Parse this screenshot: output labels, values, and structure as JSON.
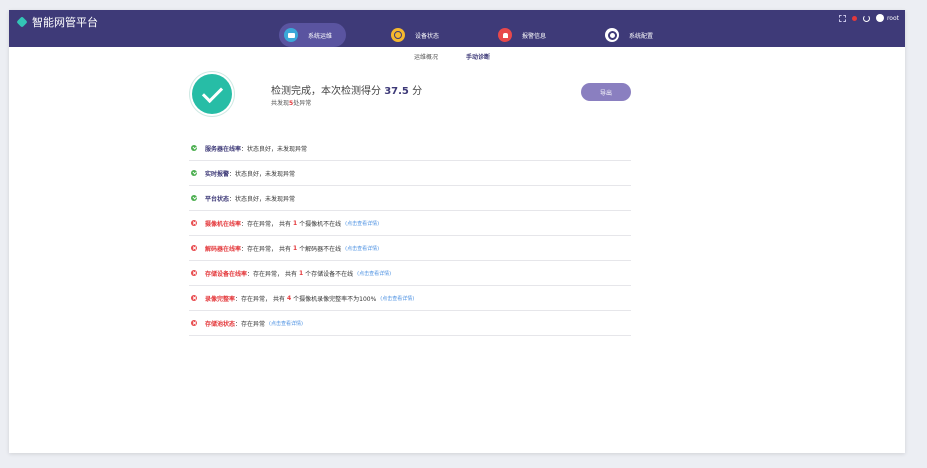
{
  "app": {
    "title": "智能网管平台"
  },
  "nav": [
    {
      "label": "系统运维",
      "icon": "monitor-icon",
      "color": "#3ba8d8",
      "active": true
    },
    {
      "label": "设备状态",
      "icon": "chart-icon",
      "color": "#f5b82e",
      "active": false
    },
    {
      "label": "报警信息",
      "icon": "bell-icon",
      "color": "#e8484b",
      "active": false
    },
    {
      "label": "系统配置",
      "icon": "gear-icon",
      "color": "#ffffff",
      "active": false
    }
  ],
  "topbar": {
    "user": "root"
  },
  "subtabs": [
    {
      "label": "运维概况",
      "active": false
    },
    {
      "label": "手动诊断",
      "active": true
    }
  ],
  "summary": {
    "title_prefix": "检测完成，本次检测得分",
    "score": "37.5",
    "title_suffix": "分",
    "sub_prefix": "共发现",
    "issue_count": "5",
    "sub_suffix": "处异常",
    "export_label": "导出"
  },
  "results": [
    {
      "status": "ok",
      "label": "服务器在线率",
      "desc": "状态良好，未发现异常"
    },
    {
      "status": "ok",
      "label": "实时报警",
      "desc": "状态良好，未发现异常"
    },
    {
      "status": "ok",
      "label": "平台状态",
      "desc": "状态良好，未发现异常"
    },
    {
      "status": "err",
      "label": "摄像机在线率",
      "desc_pre": "存在异常，  共有",
      "num": "1",
      "desc_post": "个摄像机不在线",
      "link": "(点击查看详情)"
    },
    {
      "status": "err",
      "label": "解码器在线率",
      "desc_pre": "存在异常，  共有",
      "num": "1",
      "desc_post": "个解码器不在线",
      "link": "(点击查看详情)"
    },
    {
      "status": "err",
      "label": "存储设备在线率",
      "desc_pre": "存在异常，  共有",
      "num": "1",
      "desc_post": "个存储设备不在线",
      "link": "(点击查看详情)"
    },
    {
      "status": "err",
      "label": "录像完整率",
      "desc_pre": "存在异常，  共有",
      "num": "4",
      "desc_post": "个摄像机录像完整率不为100%",
      "link": "(点击查看详情)"
    },
    {
      "status": "err",
      "label": "存储池状态",
      "desc_pre": "存在异常",
      "link": "(点击查看详情)"
    }
  ]
}
